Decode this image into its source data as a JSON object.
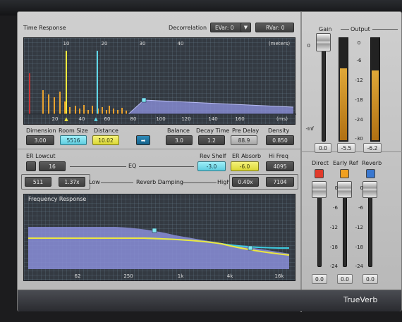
{
  "app": {
    "name": "TrueVerb"
  },
  "time_response": {
    "title": "Time Response",
    "decorrelation_label": "Decorrelation",
    "evar": "EVar: 0",
    "rvar": "RVar: 0",
    "units_meters": "(meters)",
    "units_ms": "(ms)",
    "meters_ticks": [
      "10",
      "20",
      "30",
      "40"
    ],
    "ms_ticks": [
      "20",
      "40",
      "60",
      "80",
      "100",
      "120",
      "140",
      "160"
    ]
  },
  "time_params": [
    {
      "label": "Dimension",
      "value": "3.00",
      "style": "dark"
    },
    {
      "label": "Room Size",
      "value": "5516",
      "style": "cyan"
    },
    {
      "label": "Distance",
      "value": "10.02",
      "style": "yellow"
    },
    {
      "label": "Balance",
      "value": "3.0",
      "style": "dark"
    },
    {
      "label": "Decay Time",
      "value": "1.2",
      "style": "dark"
    },
    {
      "label": "Pre Delay",
      "value": "88.9",
      "style": "gray"
    },
    {
      "label": "Density",
      "value": "0.850",
      "style": "dark"
    }
  ],
  "eq": {
    "er_lowcut_label": "ER Lowcut",
    "er_lowcut_value": "16",
    "eq_label": "EQ",
    "rev_shelf_label": "Rev Shelf",
    "rev_shelf_value": "-3.0",
    "er_absorb_label": "ER Absorb",
    "er_absorb_value": "-6.0",
    "hi_freq_label": "Hi Freq",
    "hi_freq_value": "4095",
    "low_value": "511",
    "ratio_value": "1.37x",
    "low_label": "Low",
    "damping_label": "Reverb Damping",
    "high_label": "High",
    "high_ratio_value": "0.40x",
    "high_value": "7104"
  },
  "freq_response": {
    "title": "Frequency Response",
    "ticks": [
      "62",
      "250",
      "1k",
      "4k",
      "16k"
    ]
  },
  "output": {
    "gain_label": "Gain",
    "output_label": "Output",
    "gain_scale": [
      "0",
      "-Inf"
    ],
    "out_scale": [
      "0",
      "-6",
      "-12",
      "-18",
      "-24",
      "-30"
    ],
    "gain_value": "0.0",
    "out_left": "-5.5",
    "out_right": "-6.2",
    "out_left_level": 0.7,
    "out_right_level": 0.68
  },
  "mix": {
    "direct_label": "Direct",
    "early_label": "Early Ref",
    "reverb_label": "Reverb",
    "scale": [
      "0",
      "-6",
      "-12",
      "-18",
      "-24"
    ],
    "direct_value": "0.0",
    "early_value": "0.0",
    "reverb_value": "0.0",
    "direct_color": "#e13a2a",
    "early_color": "#f0a020",
    "reverb_color": "#3a78d0"
  }
}
